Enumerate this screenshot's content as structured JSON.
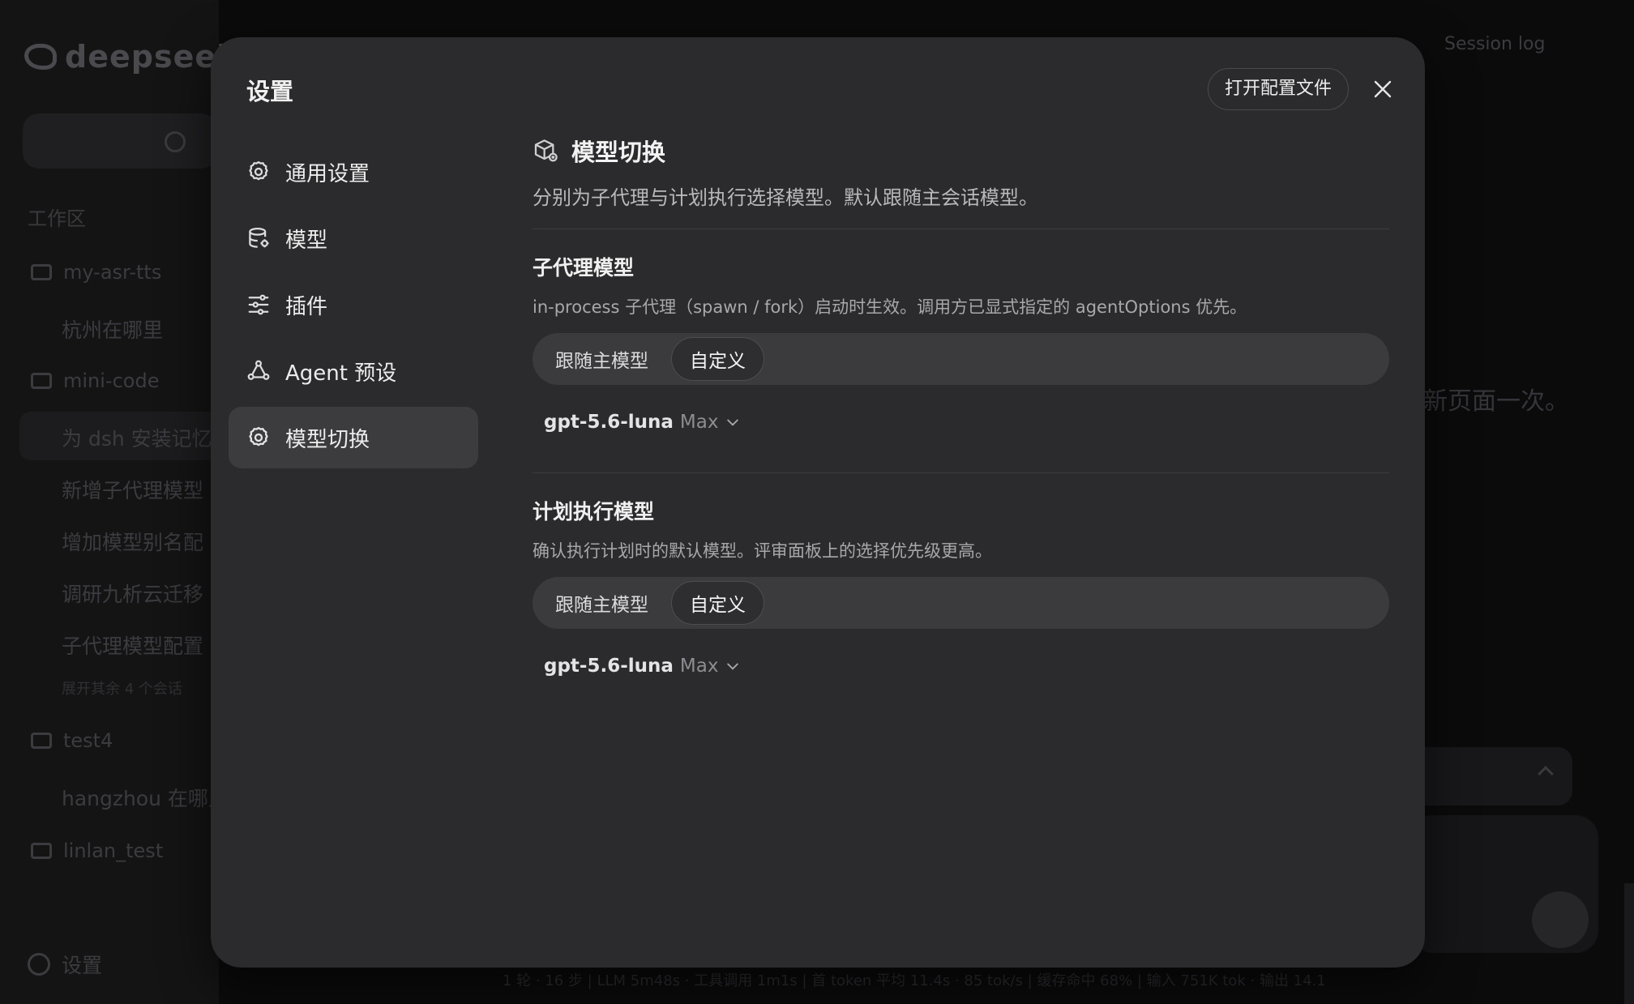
{
  "background": {
    "logo_text": "deepseek",
    "section_label": "工作区",
    "folders": [
      {
        "name": "my-asr-tts",
        "items": [
          "杭州在哪里"
        ]
      },
      {
        "name": "mini-code",
        "items": [
          "为 dsh 安装记忆",
          "新增子代理模型",
          "增加模型别名配",
          "调研九析云迁移",
          "子代理模型配置"
        ],
        "note": "展开其余 4 个会话"
      },
      {
        "name": "test4",
        "items": [
          "hangzhou 在哪里"
        ]
      },
      {
        "name": "linlan_test",
        "items": []
      }
    ],
    "settings_label": "设置",
    "session_log": "Session log",
    "reply_fragment": "新页面一次。",
    "status_bar": "1 轮 · 16 步 | LLM 5m48s · 工具调用 1m1s | 首 token 平均 11.4s · 85 tok/s | 缓存命中 68% | 输入 751K tok · 输出 14.1"
  },
  "modal": {
    "title": "设置",
    "open_config_label": "打开配置文件",
    "nav": [
      {
        "label": "通用设置",
        "icon": "gear-icon",
        "active": false
      },
      {
        "label": "模型",
        "icon": "database-icon",
        "active": false
      },
      {
        "label": "插件",
        "icon": "sliders-icon",
        "active": false
      },
      {
        "label": "Agent 预设",
        "icon": "agent-icon",
        "active": false
      },
      {
        "label": "模型切换",
        "icon": "gear-icon",
        "active": true
      }
    ],
    "content": {
      "title": "模型切换",
      "description": "分别为子代理与计划执行选择模型。默认跟随主会话模型。",
      "sections": [
        {
          "title": "子代理模型",
          "description": "in-process 子代理（spawn / fork）启动时生效。调用方已显式指定的 agentOptions 优先。",
          "options": [
            "跟随主模型",
            "自定义"
          ],
          "selected": "自定义",
          "model_name": "gpt-5.6-luna",
          "model_tier": "Max"
        },
        {
          "title": "计划执行模型",
          "description": "确认执行计划时的默认模型。评审面板上的选择优先级更高。",
          "options": [
            "跟随主模型",
            "自定义"
          ],
          "selected": "自定义",
          "model_name": "gpt-5.6-luna",
          "model_tier": "Max"
        }
      ]
    }
  }
}
